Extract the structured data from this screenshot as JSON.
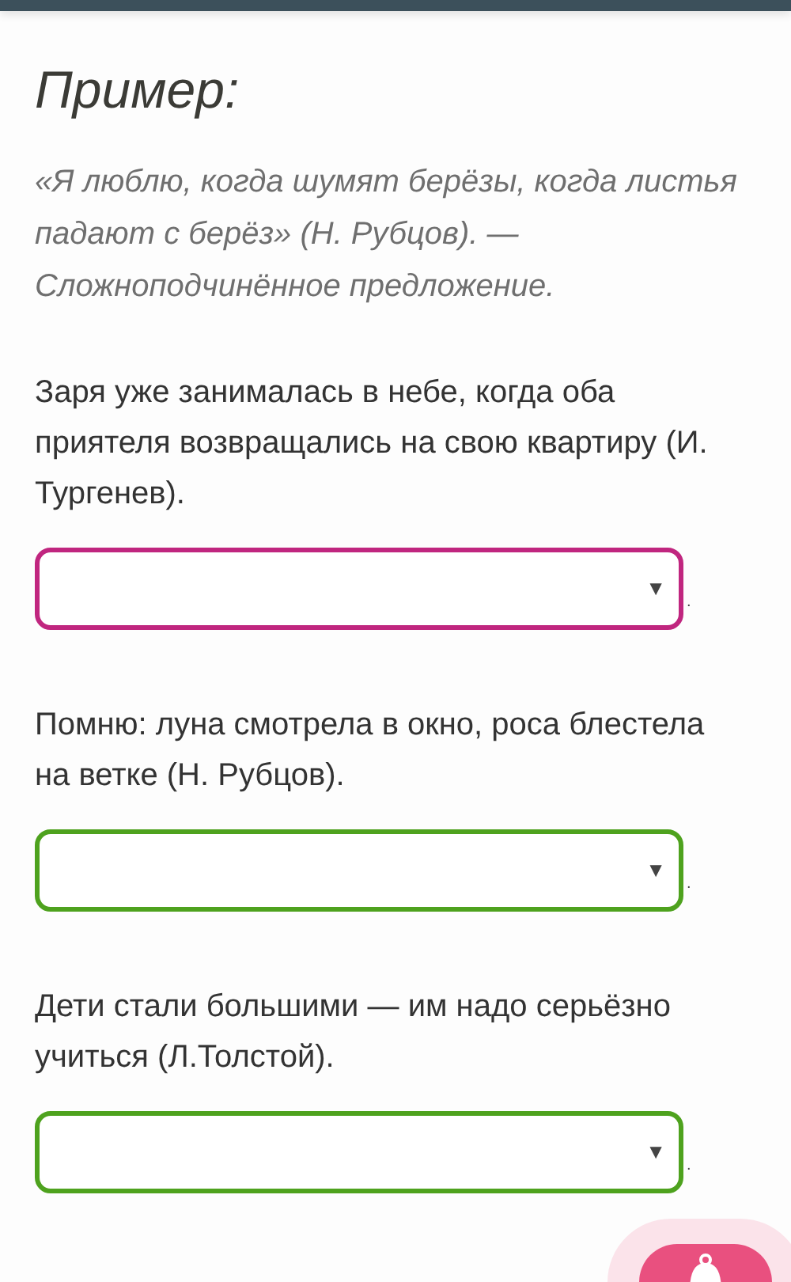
{
  "heading": "Пример:",
  "example": "«Я люблю, когда шумят берёзы, когда листья падают с берёз» (Н. Рубцов). — Сложноподчинённое предложение.",
  "questions": [
    {
      "text": "Заря уже занималась в небе, когда оба приятеля возвращались на свою квартиру (И. Тургенев).",
      "arrow": "▼",
      "after": ".",
      "color": "#c0267f"
    },
    {
      "text": "Помню: луна смотрела в окно, роса блестела на ветке (Н. Рубцов).",
      "arrow": "▼",
      "after": ".",
      "color": "#4ea21e"
    },
    {
      "text": "Дети стали большими — им надо серьёзно учиться (Л.Толстой).",
      "arrow": "▼",
      "after": ".",
      "color": "#4ea21e"
    }
  ]
}
